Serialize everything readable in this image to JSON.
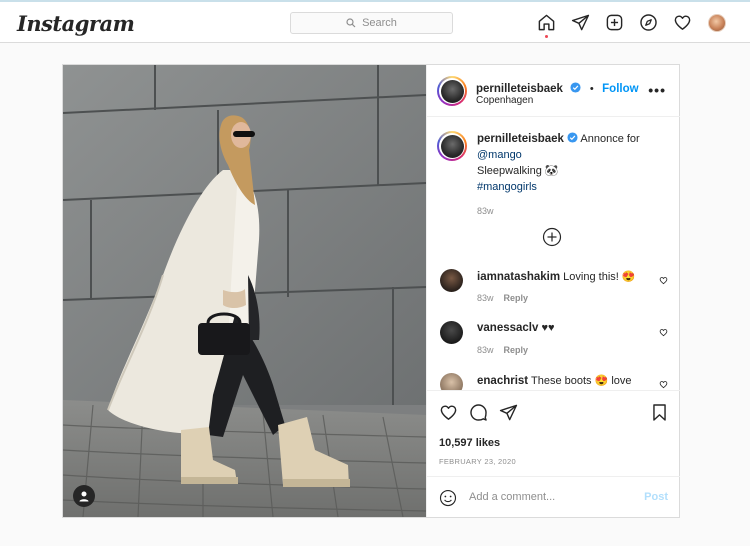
{
  "nav": {
    "logo": "Instagram",
    "search_placeholder": "Search",
    "icons": [
      "home-icon",
      "direct-icon",
      "new-post-icon",
      "explore-icon",
      "activity-icon",
      "profile-avatar"
    ]
  },
  "post": {
    "author": "pernilleteisbaek",
    "location": "Copenhagen",
    "follow_label": "Follow",
    "separator": "•",
    "more_label": "•••",
    "caption": {
      "author": "pernilleteisbaek",
      "text_prefix": "Annonce for",
      "mention": "@mango",
      "line2": "Sleepwalking 🐼",
      "hashtag": "#mangogirls",
      "time": "83w"
    },
    "comments": [
      {
        "user": "iamnatashakim",
        "text": "Loving this! 😍",
        "time": "83w",
        "reply": "Reply"
      },
      {
        "user": "vanessaclv",
        "text": "♥♥",
        "time": "83w",
        "reply": "Reply"
      },
      {
        "user": "enachrist",
        "text": "These boots 😍 love",
        "time": "",
        "reply": ""
      }
    ],
    "likes": "10,597 likes",
    "date": "FEBRUARY 23, 2020",
    "add_comment_placeholder": "Add a comment...",
    "post_button": "Post"
  },
  "colors": {
    "link_blue": "#0095f6",
    "mention_blue": "#00376b",
    "border": "#dbdbdb",
    "muted": "#8e8e8e"
  }
}
